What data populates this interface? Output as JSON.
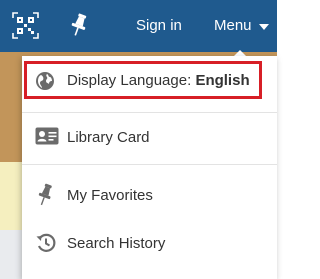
{
  "header": {
    "qr_icon": "qr-code-icon",
    "pin_icon": "pushpin-icon",
    "sign_in_label": "Sign in",
    "menu_label": "Menu",
    "menu_caret_icon": "caret-down-icon",
    "background_color": "#1f5a8e"
  },
  "dropdown": {
    "items": [
      {
        "label": "Display Language: ",
        "value": "English",
        "icon": "globe-icon",
        "highlighted": true
      },
      {
        "label": "Library Card",
        "icon": "id-card-icon"
      },
      {
        "label": "My Favorites",
        "icon": "pushpin-icon"
      },
      {
        "label": "Search History",
        "icon": "history-icon"
      }
    ],
    "highlight_color": "#d71f26"
  }
}
